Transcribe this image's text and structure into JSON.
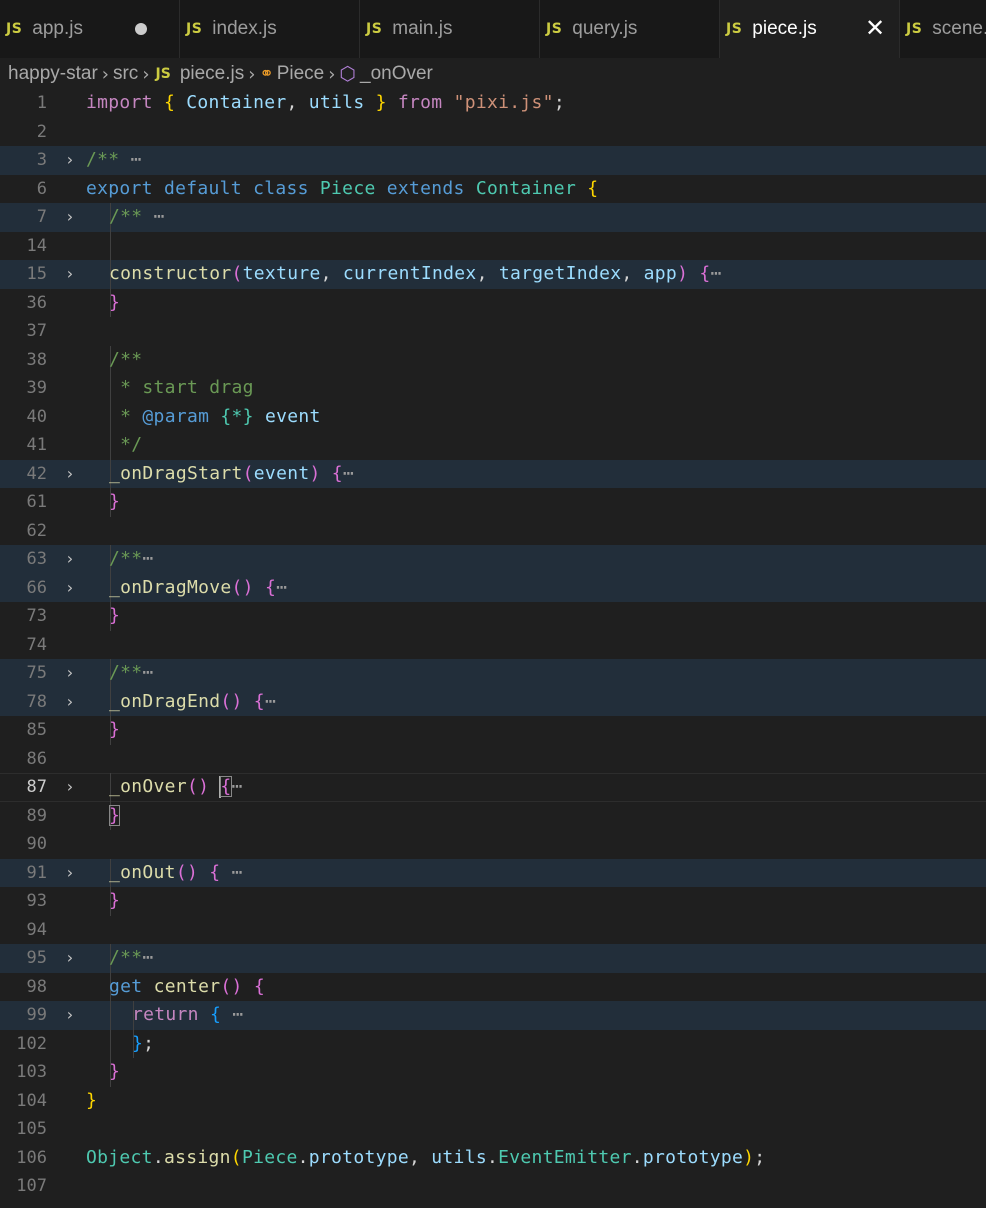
{
  "tabs": [
    {
      "label": "app.js",
      "icon": "JS",
      "modified": true,
      "active": false
    },
    {
      "label": "index.js",
      "icon": "JS",
      "active": false
    },
    {
      "label": "main.js",
      "icon": "JS",
      "active": false
    },
    {
      "label": "query.js",
      "icon": "JS",
      "active": false
    },
    {
      "label": "piece.js",
      "icon": "JS",
      "active": true,
      "close_glyph": "✕"
    },
    {
      "label": "scene.js",
      "icon": "JS",
      "active": false
    }
  ],
  "breadcrumb": {
    "project": "happy-star",
    "folder": "src",
    "file_icon": "JS",
    "file": "piece.js",
    "class_name": "Piece",
    "method": "_onOver"
  },
  "colors": {
    "keyword": "#569cd6",
    "control": "#c586c0",
    "string": "#ce9178",
    "type": "#4ec9b0",
    "variable": "#9cdcfe",
    "function": "#dcdcaa",
    "comment": "#6a9955",
    "js_icon": "#cbcb41"
  },
  "lines": [
    {
      "n": "1",
      "tokens": [
        [
          "tok-ctrl",
          "import"
        ],
        [
          "tok-punc",
          " "
        ],
        [
          "tok-b1",
          "{"
        ],
        [
          "tok-punc",
          " "
        ],
        [
          "tok-var",
          "Container"
        ],
        [
          "tok-punc",
          ", "
        ],
        [
          "tok-var",
          "utils"
        ],
        [
          "tok-punc",
          " "
        ],
        [
          "tok-b1",
          "}"
        ],
        [
          "tok-punc",
          " "
        ],
        [
          "tok-ctrl",
          "from"
        ],
        [
          "tok-punc",
          " "
        ],
        [
          "tok-str",
          "\"pixi.js\""
        ],
        [
          "tok-punc",
          ";"
        ]
      ]
    },
    {
      "n": "2",
      "tokens": []
    },
    {
      "n": "3",
      "fold": true,
      "hl": true,
      "tokens": [
        [
          "tok-com",
          "/**"
        ],
        [
          "tok-ellipsis",
          " ⋯"
        ]
      ]
    },
    {
      "n": "6",
      "tokens": [
        [
          "tok-kw",
          "export"
        ],
        [
          "tok-punc",
          " "
        ],
        [
          "tok-kw",
          "default"
        ],
        [
          "tok-punc",
          " "
        ],
        [
          "tok-kw",
          "class"
        ],
        [
          "tok-punc",
          " "
        ],
        [
          "tok-type",
          "Piece"
        ],
        [
          "tok-punc",
          " "
        ],
        [
          "tok-kw",
          "extends"
        ],
        [
          "tok-punc",
          " "
        ],
        [
          "tok-type",
          "Container"
        ],
        [
          "tok-punc",
          " "
        ],
        [
          "tok-b1",
          "{"
        ]
      ]
    },
    {
      "n": "7",
      "fold": true,
      "hl": true,
      "indent": 1,
      "tokens": [
        [
          "tok-com",
          "/**"
        ],
        [
          "tok-ellipsis",
          " ⋯"
        ]
      ]
    },
    {
      "n": "14",
      "indent": 1,
      "tokens": []
    },
    {
      "n": "15",
      "fold": true,
      "hl": true,
      "indent": 1,
      "tokens": [
        [
          "tok-fn",
          "constructor"
        ],
        [
          "tok-b2",
          "("
        ],
        [
          "tok-var",
          "texture"
        ],
        [
          "tok-punc",
          ", "
        ],
        [
          "tok-var",
          "currentIndex"
        ],
        [
          "tok-punc",
          ", "
        ],
        [
          "tok-var",
          "targetIndex"
        ],
        [
          "tok-punc",
          ", "
        ],
        [
          "tok-var",
          "app"
        ],
        [
          "tok-b2",
          ")"
        ],
        [
          "tok-punc",
          " "
        ],
        [
          "tok-b2",
          "{"
        ],
        [
          "tok-ellipsis",
          "⋯"
        ]
      ]
    },
    {
      "n": "36",
      "indent": 1,
      "tokens": [
        [
          "tok-b2",
          "}"
        ]
      ]
    },
    {
      "n": "37",
      "tokens": []
    },
    {
      "n": "38",
      "indent": 1,
      "tokens": [
        [
          "tok-com",
          "/**"
        ]
      ]
    },
    {
      "n": "39",
      "indent": 1,
      "tokens": [
        [
          "tok-com",
          " * start drag"
        ]
      ]
    },
    {
      "n": "40",
      "indent": 1,
      "tokens": [
        [
          "tok-com",
          " * "
        ],
        [
          "tok-kw",
          "@param"
        ],
        [
          "tok-punc",
          " "
        ],
        [
          "tok-type",
          "{*}"
        ],
        [
          "tok-punc",
          " "
        ],
        [
          "tok-var",
          "event"
        ]
      ]
    },
    {
      "n": "41",
      "indent": 1,
      "tokens": [
        [
          "tok-com",
          " */"
        ]
      ]
    },
    {
      "n": "42",
      "fold": true,
      "hl": true,
      "indent": 1,
      "tokens": [
        [
          "tok-fn",
          "_onDragStart"
        ],
        [
          "tok-b2",
          "("
        ],
        [
          "tok-var",
          "event"
        ],
        [
          "tok-b2",
          ")"
        ],
        [
          "tok-punc",
          " "
        ],
        [
          "tok-b2",
          "{"
        ],
        [
          "tok-ellipsis",
          "⋯"
        ]
      ]
    },
    {
      "n": "61",
      "indent": 1,
      "tokens": [
        [
          "tok-b2",
          "}"
        ]
      ]
    },
    {
      "n": "62",
      "tokens": []
    },
    {
      "n": "63",
      "fold": true,
      "hl": true,
      "indent": 1,
      "tokens": [
        [
          "tok-com",
          "/**"
        ],
        [
          "tok-ellipsis",
          "⋯"
        ]
      ]
    },
    {
      "n": "66",
      "fold": true,
      "hl": true,
      "indent": 1,
      "tokens": [
        [
          "tok-fn",
          "_onDragMove"
        ],
        [
          "tok-b2",
          "()"
        ],
        [
          "tok-punc",
          " "
        ],
        [
          "tok-b2",
          "{"
        ],
        [
          "tok-ellipsis",
          "⋯"
        ]
      ]
    },
    {
      "n": "73",
      "indent": 1,
      "tokens": [
        [
          "tok-b2",
          "}"
        ]
      ]
    },
    {
      "n": "74",
      "tokens": []
    },
    {
      "n": "75",
      "fold": true,
      "hl": true,
      "indent": 1,
      "tokens": [
        [
          "tok-com",
          "/**"
        ],
        [
          "tok-ellipsis",
          "⋯"
        ]
      ]
    },
    {
      "n": "78",
      "fold": true,
      "hl": true,
      "indent": 1,
      "tokens": [
        [
          "tok-fn",
          "_onDragEnd"
        ],
        [
          "tok-b2",
          "()"
        ],
        [
          "tok-punc",
          " "
        ],
        [
          "tok-b2",
          "{"
        ],
        [
          "tok-ellipsis",
          "⋯"
        ]
      ]
    },
    {
      "n": "85",
      "indent": 1,
      "tokens": [
        [
          "tok-b2",
          "}"
        ]
      ]
    },
    {
      "n": "86",
      "tokens": []
    },
    {
      "n": "87",
      "fold": true,
      "current": true,
      "indent": 1,
      "tokens": [
        [
          "tok-fn",
          "_onOver"
        ],
        [
          "tok-b2",
          "()"
        ],
        [
          "tok-punc",
          " "
        ],
        [
          "cursor",
          ""
        ],
        [
          "tok-b2 tok-match",
          "{"
        ],
        [
          "tok-ellipsis",
          "⋯"
        ]
      ]
    },
    {
      "n": "89",
      "indent": 1,
      "tokens": [
        [
          "tok-b2 tok-match",
          "}"
        ]
      ]
    },
    {
      "n": "90",
      "tokens": []
    },
    {
      "n": "91",
      "fold": true,
      "hl": true,
      "indent": 1,
      "tokens": [
        [
          "tok-fn",
          "_onOut"
        ],
        [
          "tok-b2",
          "()"
        ],
        [
          "tok-punc",
          " "
        ],
        [
          "tok-b2",
          "{"
        ],
        [
          "tok-ellipsis",
          " ⋯"
        ]
      ]
    },
    {
      "n": "93",
      "indent": 1,
      "tokens": [
        [
          "tok-b2",
          "}"
        ]
      ]
    },
    {
      "n": "94",
      "tokens": []
    },
    {
      "n": "95",
      "fold": true,
      "hl": true,
      "indent": 1,
      "tokens": [
        [
          "tok-com",
          "/**"
        ],
        [
          "tok-ellipsis",
          "⋯"
        ]
      ]
    },
    {
      "n": "98",
      "indent": 1,
      "tokens": [
        [
          "tok-kw",
          "get"
        ],
        [
          "tok-punc",
          " "
        ],
        [
          "tok-fn",
          "center"
        ],
        [
          "tok-b2",
          "()"
        ],
        [
          "tok-punc",
          " "
        ],
        [
          "tok-b2",
          "{"
        ]
      ]
    },
    {
      "n": "99",
      "fold": true,
      "hl": true,
      "indent": 2,
      "tokens": [
        [
          "tok-ctrl",
          "return"
        ],
        [
          "tok-punc",
          " "
        ],
        [
          "tok-b3",
          "{"
        ],
        [
          "tok-ellipsis",
          " ⋯"
        ]
      ]
    },
    {
      "n": "102",
      "indent": 2,
      "tokens": [
        [
          "tok-b3",
          "}"
        ],
        [
          "tok-punc",
          ";"
        ]
      ]
    },
    {
      "n": "103",
      "indent": 1,
      "tokens": [
        [
          "tok-b2",
          "}"
        ]
      ]
    },
    {
      "n": "104",
      "tokens": [
        [
          "tok-b1",
          "}"
        ]
      ]
    },
    {
      "n": "105",
      "tokens": []
    },
    {
      "n": "106",
      "tokens": [
        [
          "tok-type",
          "Object"
        ],
        [
          "tok-punc",
          "."
        ],
        [
          "tok-fn",
          "assign"
        ],
        [
          "tok-b1",
          "("
        ],
        [
          "tok-type",
          "Piece"
        ],
        [
          "tok-punc",
          "."
        ],
        [
          "tok-var",
          "prototype"
        ],
        [
          "tok-punc",
          ", "
        ],
        [
          "tok-var",
          "utils"
        ],
        [
          "tok-punc",
          "."
        ],
        [
          "tok-type",
          "EventEmitter"
        ],
        [
          "tok-punc",
          "."
        ],
        [
          "tok-var",
          "prototype"
        ],
        [
          "tok-b1",
          ")"
        ],
        [
          "tok-punc",
          ";"
        ]
      ]
    },
    {
      "n": "107",
      "tokens": []
    }
  ]
}
